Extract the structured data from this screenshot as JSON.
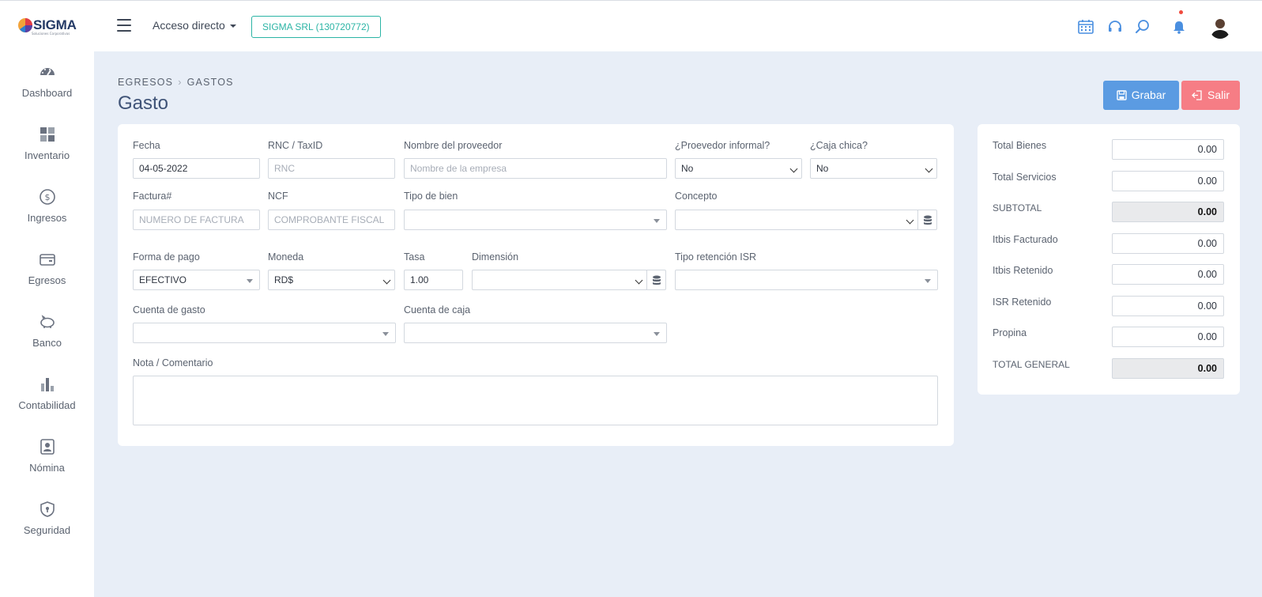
{
  "brand": {
    "name": "SIGMA",
    "tagline": "Soluciones Corporativas"
  },
  "header": {
    "quick_access": "Acceso directo",
    "company": "SIGMA SRL (130720772)"
  },
  "sidebar": {
    "items": [
      {
        "label": "Dashboard",
        "icon": "speedometer-icon"
      },
      {
        "label": "Inventario",
        "icon": "grid-icon"
      },
      {
        "label": "Ingresos",
        "icon": "dollar-circle-icon"
      },
      {
        "label": "Egresos",
        "icon": "wallet-icon"
      },
      {
        "label": "Banco",
        "icon": "piggy-bank-icon"
      },
      {
        "label": "Contabilidad",
        "icon": "bar-chart-icon"
      },
      {
        "label": "Nómina",
        "icon": "id-badge-icon"
      },
      {
        "label": "Seguridad",
        "icon": "shield-icon"
      }
    ]
  },
  "breadcrumb": {
    "parent": "EGRESOS",
    "current": "GASTOS"
  },
  "page_title": "Gasto",
  "actions": {
    "save": "Grabar",
    "exit": "Salir"
  },
  "form": {
    "fecha": {
      "label": "Fecha",
      "value": "04-05-2022"
    },
    "rnc": {
      "label": "RNC / TaxID",
      "placeholder": "RNC"
    },
    "proveedor": {
      "label": "Nombre del proveedor",
      "placeholder": "Nombre de la empresa"
    },
    "informal": {
      "label": "¿Proevedor informal?",
      "value": "No"
    },
    "caja_chica": {
      "label": "¿Caja chica?",
      "value": "No"
    },
    "factura": {
      "label": "Factura#",
      "placeholder": "NUMERO DE FACTURA"
    },
    "ncf": {
      "label": "NCF",
      "placeholder": "COMPROBANTE FISCAL"
    },
    "tipo_bien": {
      "label": "Tipo de bien",
      "value": ""
    },
    "concepto": {
      "label": "Concepto",
      "value": ""
    },
    "forma_pago": {
      "label": "Forma de pago",
      "value": "EFECTIVO"
    },
    "moneda": {
      "label": "Moneda",
      "value": "RD$"
    },
    "tasa": {
      "label": "Tasa",
      "value": "1.00"
    },
    "dimension": {
      "label": "Dimensión",
      "value": ""
    },
    "retencion_isr": {
      "label": "Tipo retención ISR",
      "value": ""
    },
    "cuenta_gasto": {
      "label": "Cuenta de gasto",
      "value": ""
    },
    "cuenta_caja": {
      "label": "Cuenta de caja",
      "value": ""
    },
    "nota": {
      "label": "Nota / Comentario",
      "value": ""
    }
  },
  "totals": {
    "bienes": {
      "label": "Total Bienes",
      "value": "0.00"
    },
    "servicios": {
      "label": "Total Servicios",
      "value": "0.00"
    },
    "subtotal": {
      "label": "SUBTOTAL",
      "value": "0.00"
    },
    "itbis_facturado": {
      "label": "Itbis Facturado",
      "value": "0.00"
    },
    "itbis_retenido": {
      "label": "Itbis Retenido",
      "value": "0.00"
    },
    "isr_retenido": {
      "label": "ISR Retenido",
      "value": "0.00"
    },
    "propina": {
      "label": "Propina",
      "value": "0.00"
    },
    "total_general": {
      "label": "TOTAL GENERAL",
      "value": "0.00"
    }
  },
  "colors": {
    "accent": "#5b9be2",
    "danger": "#f67d85",
    "teal": "#2bb4a5",
    "background": "#e8eef7"
  }
}
